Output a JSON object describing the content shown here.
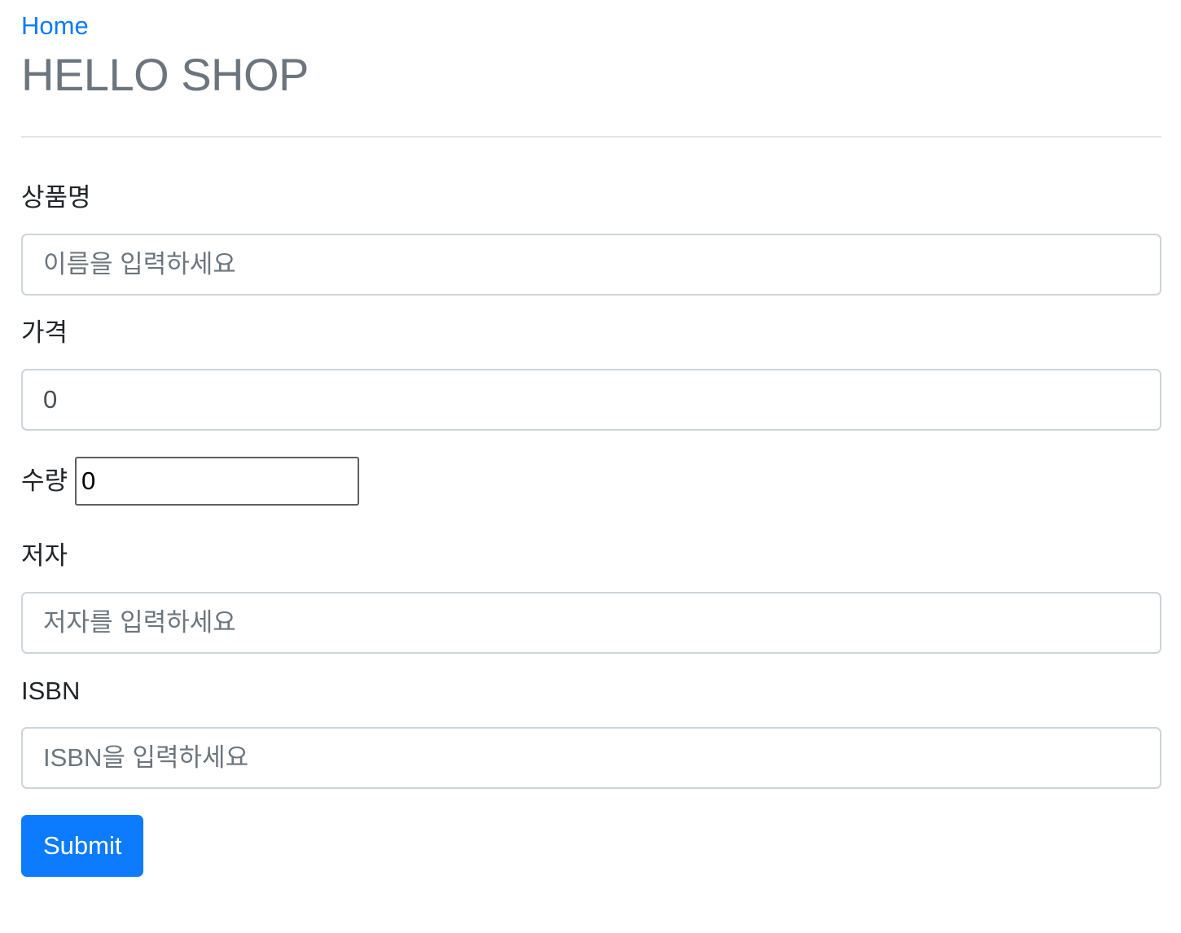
{
  "header": {
    "home_link": "Home",
    "title": "HELLO SHOP"
  },
  "form": {
    "name": {
      "label": "상품명",
      "placeholder": "이름을 입력하세요",
      "value": ""
    },
    "price": {
      "label": "가격",
      "value": "0"
    },
    "quantity": {
      "label": "수량",
      "value": "0"
    },
    "author": {
      "label": "저자",
      "placeholder": "저자를 입력하세요",
      "value": ""
    },
    "isbn": {
      "label": "ISBN",
      "placeholder": "ISBN을 입력하세요",
      "value": ""
    },
    "submit_label": "Submit"
  },
  "colors": {
    "accent": "#0d7bfd",
    "title": "#6c757d",
    "border": "#ced4da",
    "divider": "#e3e5e7"
  }
}
